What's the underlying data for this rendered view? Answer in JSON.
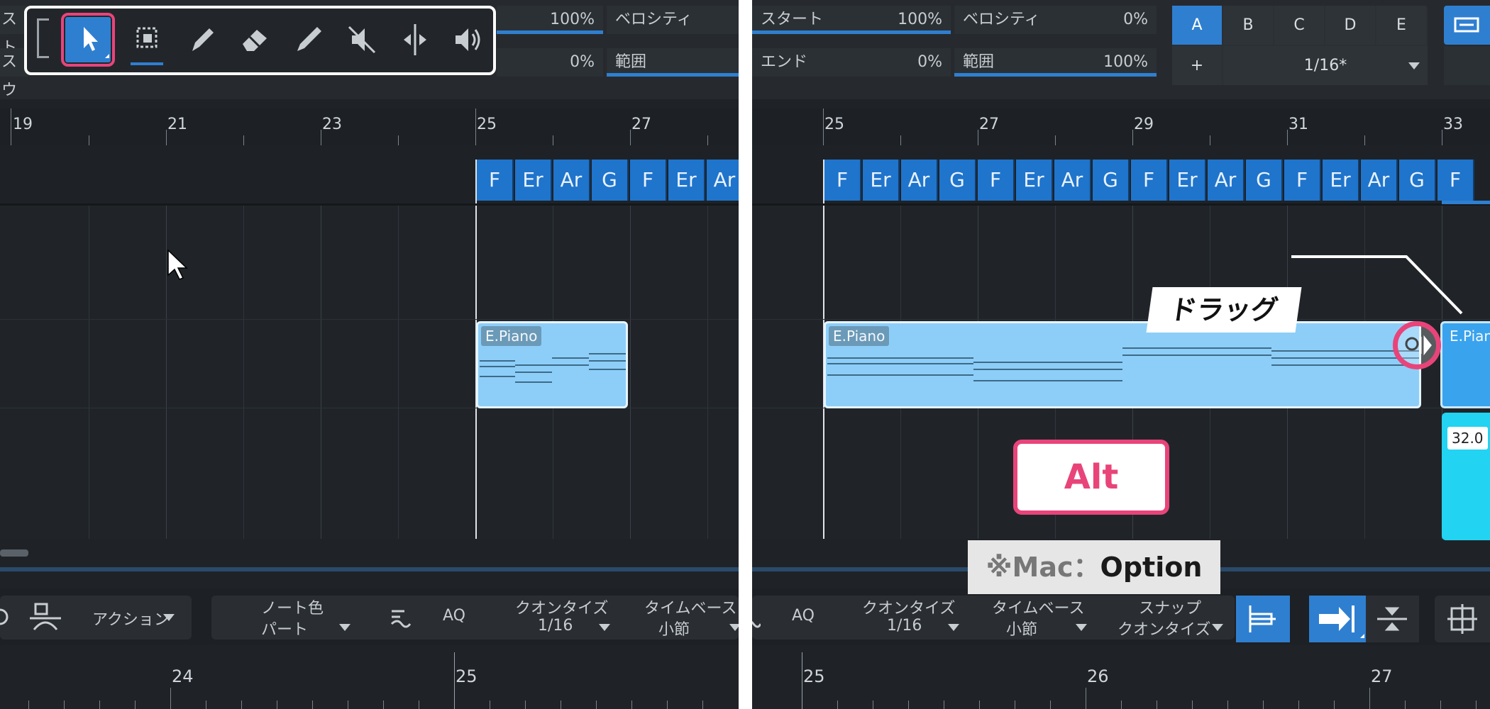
{
  "left": {
    "toolbar": {
      "partial_text_1": "スト",
      "partial_text_2": "スウィ",
      "velocity_label": "ベロシティ",
      "range_label": "範囲",
      "value_top": "100%",
      "value_bottom": "0%",
      "tools": [
        "arrow-tool-icon",
        "range-tool-icon",
        "pencil-tool-icon",
        "eraser-tool-icon",
        "paint-tool-icon",
        "mute-tool-icon",
        "split-tool-icon",
        "listen-tool-icon"
      ]
    },
    "ruler_numbers": [
      "19",
      "21",
      "23",
      "25",
      "27"
    ],
    "chords": [
      "F",
      "Er",
      "Ar",
      "G",
      "F",
      "Er",
      "Ar"
    ],
    "clip_label": "E.Piano",
    "bottom": {
      "action_label": "アクション",
      "note_color_label": "ノート色",
      "note_color_value": "パート",
      "aq_label": "AQ",
      "quantize_label": "クオンタイズ",
      "quantize_value": "1/16",
      "timebase_label": "タイムベース",
      "timebase_value": "小節"
    },
    "bottom_ruler": [
      "24",
      "25"
    ]
  },
  "right": {
    "toolbar": {
      "start_label": "スタート",
      "start_value": "100%",
      "end_label": "エンド",
      "end_value": "0%",
      "velocity_label": "ベロシティ",
      "velocity_value": "0%",
      "range_label": "範囲",
      "range_value": "100%",
      "segments": [
        "A",
        "B",
        "C",
        "D",
        "E"
      ],
      "plus_label": "+",
      "grid_value": "1/16*"
    },
    "ruler_numbers": [
      "25",
      "27",
      "29",
      "31",
      "33"
    ],
    "chords": [
      "F",
      "Er",
      "Ar",
      "G",
      "F",
      "Er",
      "Ar",
      "G",
      "F",
      "Er",
      "Ar",
      "G",
      "F",
      "Er",
      "Ar",
      "G",
      "F"
    ],
    "clip_label": "E.Piano",
    "clip2_label": "E.Pian",
    "value_box": "32.0",
    "callout_text": "ドラッグ",
    "alt_key": "Alt",
    "mac_note_prefix": "※Mac：",
    "mac_note_key": "Option",
    "bottom": {
      "aq_label": "AQ",
      "quantize_label": "クオンタイズ",
      "quantize_value": "1/16",
      "timebase_label": "タイムベース",
      "timebase_value": "小節",
      "snap_label": "スナップ",
      "snap_value": "クオンタイズ"
    },
    "bottom_ruler": [
      "25",
      "26",
      "27"
    ]
  },
  "colors": {
    "accent_blue": "#2f7fd0",
    "clip_fill": "#8dcef8",
    "highlight_pink": "#e8447a"
  }
}
